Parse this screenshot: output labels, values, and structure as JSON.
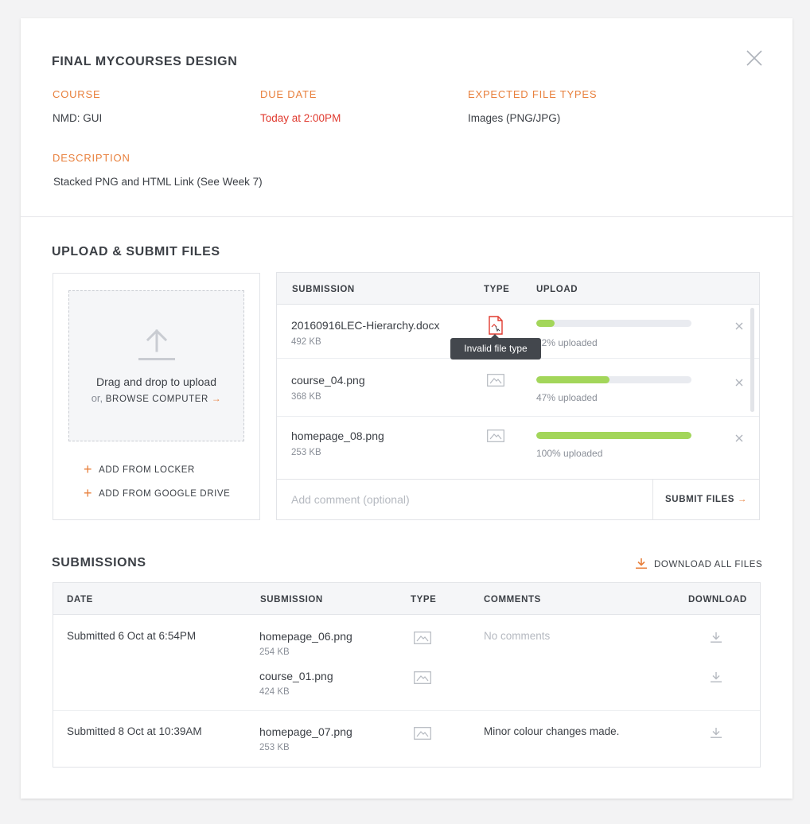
{
  "modal": {
    "title": "FINAL MYCOURSES DESIGN",
    "close_icon": "close-icon"
  },
  "details": {
    "course_label": "COURSE",
    "course_value": "NMD: GUI",
    "due_label": "DUE DATE",
    "due_value": "Today at 2:00PM",
    "types_label": "EXPECTED FILE TYPES",
    "types_value": "Images (PNG/JPG)",
    "description_label": "DESCRIPTION",
    "description_value": "Stacked PNG and HTML Link (See Week 7)"
  },
  "upload": {
    "section_title": "UPLOAD & SUBMIT FILES",
    "dropzone_text": "Drag and drop to upload",
    "dropzone_or": "or,",
    "browse_label": "BROWSE COMPUTER",
    "browse_arrow": "→",
    "add_locker": "ADD FROM LOCKER",
    "add_drive": "ADD FROM GOOGLE DRIVE",
    "plus": "+",
    "columns": {
      "submission": "SUBMISSION",
      "type": "TYPE",
      "upload": "UPLOAD"
    },
    "files": [
      {
        "name": "20160916LEC-Hierarchy.docx",
        "size": "492 KB",
        "type": "document-invalid",
        "progress": 12,
        "progress_text": "12% uploaded"
      },
      {
        "name": "course_04.png",
        "size": "368 KB",
        "type": "image",
        "progress": 47,
        "progress_text": "47% uploaded"
      },
      {
        "name": "homepage_08.png",
        "size": "253 KB",
        "type": "image",
        "progress": 100,
        "progress_text": "100% uploaded"
      }
    ],
    "tooltip": "Invalid file type",
    "comment_placeholder": "Add comment (optional)",
    "submit_label": "SUBMIT FILES",
    "submit_arrow": "→"
  },
  "submissions": {
    "section_title": "SUBMISSIONS",
    "download_all": "DOWNLOAD ALL FILES",
    "columns": {
      "date": "DATE",
      "submission": "SUBMISSION",
      "type": "TYPE",
      "comments": "COMMENTS",
      "download": "DOWNLOAD"
    },
    "groups": [
      {
        "date": "Submitted 6 Oct at 6:54PM",
        "comment": "No comments",
        "files": [
          {
            "name": "homepage_06.png",
            "size": "254 KB",
            "type": "image"
          },
          {
            "name": "course_01.png",
            "size": "424 KB",
            "type": "image"
          }
        ]
      },
      {
        "date": "Submitted 8 Oct at 10:39AM",
        "comment": "Minor colour changes made.",
        "files": [
          {
            "name": "homepage_07.png",
            "size": "253 KB",
            "type": "image"
          }
        ]
      }
    ]
  },
  "colors": {
    "accent": "#e8803d",
    "danger": "#e03a2f",
    "progress": "#a3d65a",
    "track": "#e9ebf0"
  }
}
